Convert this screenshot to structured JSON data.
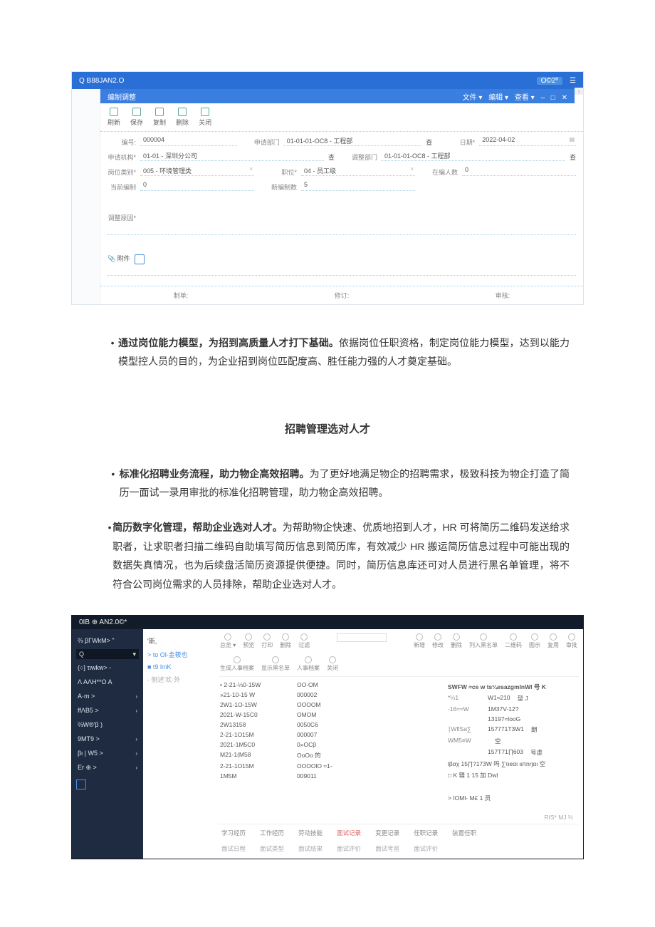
{
  "app1": {
    "logo": "Q B88JAN2.O",
    "top_badge": "O©2º",
    "top_menu_icon": "☰",
    "crumb_arrow": "›",
    "tab_title": "编制调整",
    "win_btns": [
      "文件 ▾",
      "编辑 ▾",
      "查看 ▾",
      "–",
      "□",
      "✕"
    ],
    "tools": [
      "刷新",
      "保存",
      "复制",
      "删除",
      "关闭"
    ],
    "fields": {
      "code_l": "编号:",
      "code_v": "000004",
      "dept_l": "申请部门",
      "dept_v": "01-01-01-OC8 - 工程部",
      "dept_suf": "查",
      "date_l": "日期*",
      "date_v": "2022-04-02",
      "org_l": "申请机构*",
      "org_v": "01-01 - 深圳分公司",
      "org_suf": "查",
      "tdept_l": "调整部门",
      "tdept_v": "01-01-01-OC8 - 工程部",
      "tdept_suf": "查",
      "cls_l": "岗位类别*",
      "cls_v": "005 - 环境管理类",
      "job_l": "职位*",
      "job_v": "04 - 员工级",
      "cur_l": "在编人数",
      "cur_v": "0",
      "now_l": "当前编制",
      "now_v": "0",
      "new_l": "新编制数",
      "new_v": "5",
      "reason_l": "调整原因*",
      "attach_l": "📎 附件"
    },
    "footer": [
      "制单:",
      "修订:",
      "审核:"
    ]
  },
  "para1_bold": "通过岗位能力模型，为招到高质量人才打下基础。",
  "para1_rest": "依据岗位任职资格，制定岗位能力模型，达到以能力模型控人员的目的，为企业招到岗位匹配度高、胜任能力强的人才奠定基础。",
  "section_title": "招聘管理选对人才",
  "para2_bold": "标准化招聘业务流程，助力物企高效招聘。",
  "para2_rest": "为了更好地满足物企的招聘需求，极致科技为物企打造了简历一面试一录用审批的标准化招聘管理，助力物企高效招聘。",
  "para3_bold": "简历数字化管理，帮助企业选对人才。",
  "para3_rest": "为帮助物企快速、优质地招到人才，HR 可将简历二维码发送给求职者，让求职者扫描二维码自助填写简历信息到简历库，有效减少 HR 搬运简历信息过程中可能出现的数据失真情况，也为后续盘活简历资源提供便捷。同时，简历信息库还可对人员进行黑名单管理，将不符合公司岗位需求的人员排除，帮助企业选对人才。",
  "app2": {
    "logo": "0IB ⊕ AN2.0©*",
    "side": [
      "⅔ βΓWkM> \"",
      "Q",
      "(○] τιwkw> -",
      "Λ AΛH**O A",
      "A·m >",
      "ffΛB5 >",
      "⅔W®'β )",
      "9MT9 >",
      "βι | W5 >",
      "Er ⊕ >"
    ],
    "tree_head": "'斯,",
    "tree_n1": "> to Ol-金筱也",
    "tree_n2": "■ t9 lmK",
    "tree_n3": "- 侧述'欢·外",
    "toolbar": [
      "总览 ▾",
      "预览",
      "打印",
      "删除",
      "过滤",
      "",
      "新增",
      "修改",
      "删除",
      "列入黑名单",
      "二维码",
      "图示",
      "复用",
      "审批",
      "生成人事档案",
      "显示黑名单",
      "人事档案",
      "关闭"
    ],
    "rows": [
      [
        "• 2-21-⅓0-15W",
        "OO-OM"
      ],
      [
        "»21-10-15 W",
        "000002"
      ],
      [
        "2W1-1O-15W",
        "OOOOM"
      ],
      [
        "2021-W-15C0",
        "OMOM"
      ],
      [
        "2W13158",
        "0050C6"
      ],
      [
        "2-21-1O15M",
        "000007"
      ],
      [
        "2021-1M5C0",
        "0»OCβ"
      ],
      [
        "M21-1(M58",
        "OoOo 的"
      ],
      [
        "2-21-1O15M",
        "OOOOlO ≈1-"
      ],
      [
        "1M5M",
        "009011"
      ]
    ],
    "info_top": "SWFW ≈ce w ts¼esazgmlnWl    号 K",
    "info": [
      [
        "*⅓1",
        "W1≈210",
        "型 J"
      ],
      [
        "-16≈≈W",
        "1M37V-12?",
        ""
      ],
      [
        "",
        "13197≈looG",
        ""
      ],
      [
        "∣WflSa∑",
        "157771T3W1",
        "朗"
      ],
      [
        "WM5≡W",
        "",
        "空"
      ],
      [
        "",
        "157T71∏603",
        "号虚"
      ],
      [
        "lβαχ 15∏?173W 吗 ∑τιeαι ιιπnrjαι 空",
        "",
        ""
      ],
      [
        "□ K 辑 1 15 加 Dwl",
        "",
        ""
      ]
    ],
    "info_foot": "> IOMl- M£ 1 员",
    "pager": "RIS* MJ ⅔",
    "tabs1": [
      "学习经历",
      "工作经历",
      "劳动技能",
      "面试记录",
      "变更记录",
      "任职记录",
      "装置任职"
    ],
    "tabs2": [
      "面试日程",
      "面试类型",
      "面试结果",
      "面试评价",
      "面试考官",
      "面试评价"
    ]
  }
}
